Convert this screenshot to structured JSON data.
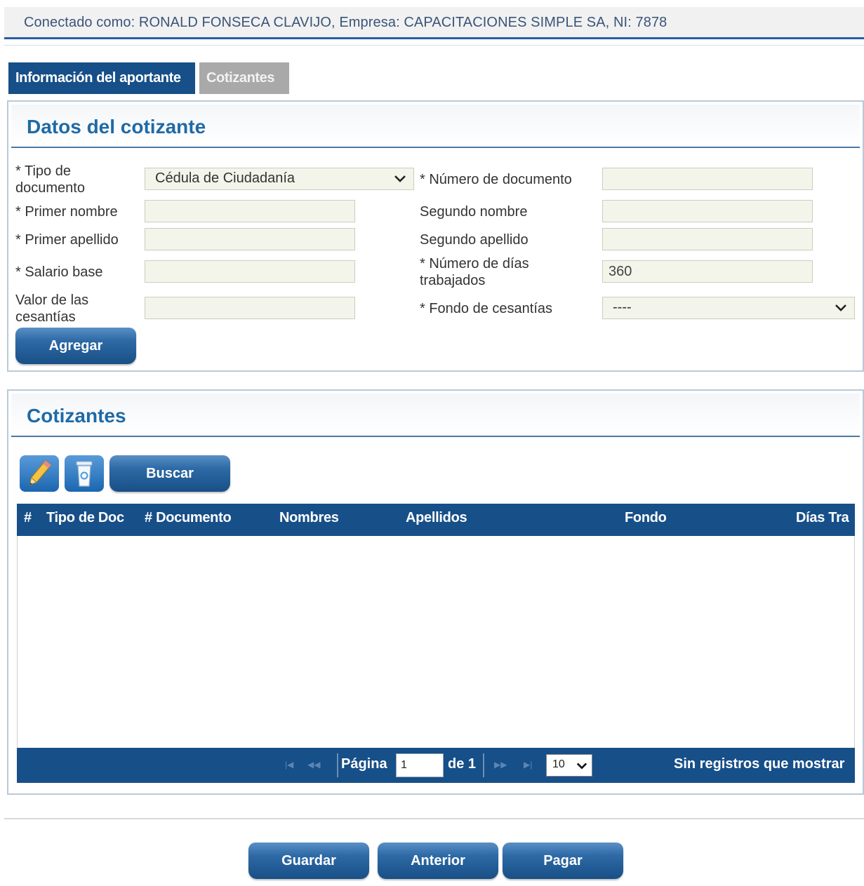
{
  "connection_bar": {
    "text": "Conectado como: RONALD FONSECA CLAVIJO, Empresa: CAPACITACIONES SIMPLE SA, NI: 7878"
  },
  "tabs": [
    {
      "label": "Información del aportante",
      "active": true
    },
    {
      "label": "Cotizantes",
      "active": false
    }
  ],
  "form": {
    "title": "Datos del cotizante",
    "tipo_documento": {
      "label_line1": "* Tipo de",
      "label_line2": "documento",
      "value": "Cédula de Ciudadanía"
    },
    "numero_documento": {
      "label": "* Número de documento",
      "value": ""
    },
    "primer_nombre": {
      "label": "* Primer nombre",
      "value": ""
    },
    "segundo_nombre": {
      "label": "Segundo nombre",
      "value": ""
    },
    "primer_apellido": {
      "label": "* Primer apellido",
      "value": ""
    },
    "segundo_apellido": {
      "label": "Segundo apellido",
      "value": ""
    },
    "salario_base": {
      "label": "* Salario base",
      "value": ""
    },
    "numero_dias": {
      "label_line1": "* Número de días",
      "label_line2": "trabajados",
      "value": "360"
    },
    "valor_cesantias": {
      "label_line1": "Valor de las",
      "label_line2": "cesantías",
      "value": ""
    },
    "fondo_cesantias": {
      "label": "* Fondo de cesantías",
      "value": "----"
    },
    "add_button": "Agregar"
  },
  "cotizantes": {
    "title": "Cotizantes",
    "toolbar": {
      "edit_icon": "pencil-icon",
      "delete_icon": "trash-icon",
      "search_button": "Buscar"
    },
    "columns": [
      "#",
      "Tipo de Doc",
      "# Documento",
      "Nombres",
      "Apellidos",
      "Fondo",
      "Días Tra"
    ],
    "rows": [],
    "pager": {
      "page_label": "Página",
      "page_value": "1",
      "of_label": "de 1",
      "page_size": "10",
      "status": "Sin registros que mostrar"
    }
  },
  "footer_buttons": {
    "save": "Guardar",
    "previous": "Anterior",
    "pay": "Pagar"
  },
  "colors": {
    "primary": "#174f88",
    "title": "#1f6aa6",
    "field_bg": "#f3f5ea",
    "tab_inactive": "#a9a9a9"
  }
}
